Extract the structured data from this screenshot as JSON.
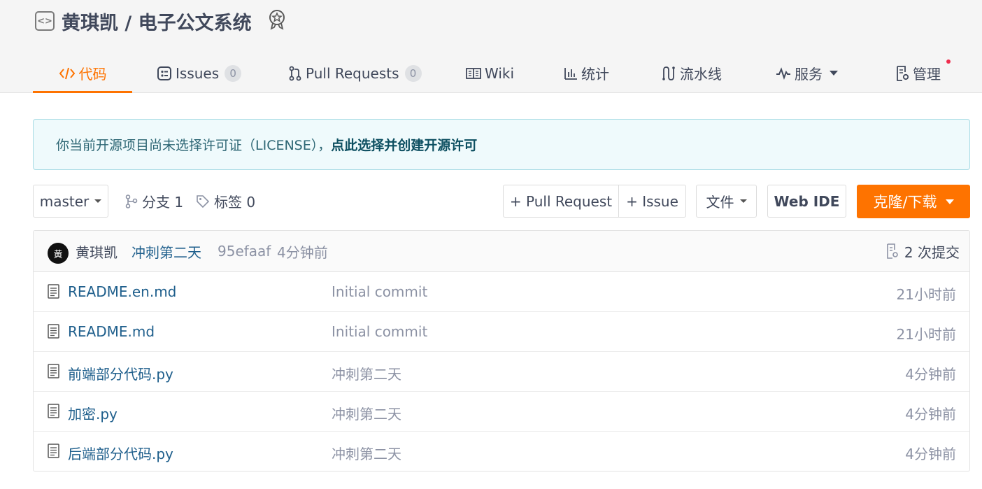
{
  "repo": {
    "title": "黄琪凯 / 电子公文系统",
    "repo_icon": "code-brackets-icon",
    "badge_icon": "award-icon"
  },
  "tabs": [
    {
      "label": "代码",
      "icon": "code-icon",
      "active": true
    },
    {
      "label": "Issues",
      "icon": "issues-icon",
      "count": "0"
    },
    {
      "label": "Pull Requests",
      "icon": "pull-request-icon",
      "count": "0"
    },
    {
      "label": "Wiki",
      "icon": "book-icon"
    },
    {
      "label": "统计",
      "icon": "bar-chart-icon"
    },
    {
      "label": "流水线",
      "icon": "pipeline-icon"
    },
    {
      "label": "服务",
      "icon": "activity-icon",
      "dropdown": true
    },
    {
      "label": "管理",
      "icon": "settings-doc-icon",
      "notification_dot": true
    }
  ],
  "notice": {
    "text": "你当前开源项目尚未选择许可证（LICENSE），",
    "link": "点此选择并创建开源许可"
  },
  "toolbar": {
    "branch": "master",
    "branches_label": "分支 1",
    "tags_label": "标签 0",
    "pull_request_button": "+ Pull Request",
    "issue_button": "+ Issue",
    "file_button": "文件",
    "web_ide_button": "Web IDE",
    "clone_button": "克隆/下载"
  },
  "last_commit": {
    "avatar_text": "黄",
    "author": "黄琪凯",
    "message": "冲刺第二天",
    "sha": "95efaaf",
    "time": "4分钟前",
    "commit_count": "2 次提交"
  },
  "files": [
    {
      "name": "README.en.md",
      "commit": "Initial commit",
      "time": "21小时前"
    },
    {
      "name": "README.md",
      "commit": "Initial commit",
      "time": "21小时前"
    },
    {
      "name": "前端部分代码.py",
      "commit": "冲刺第二天",
      "time": "4分钟前"
    },
    {
      "name": "加密.py",
      "commit": "冲刺第二天",
      "time": "4分钟前"
    },
    {
      "name": "后端部分代码.py",
      "commit": "冲刺第二天",
      "time": "4分钟前"
    }
  ],
  "colors": {
    "accent": "#fe7300",
    "link": "#1f5f8c",
    "notice_bg": "#effafc",
    "notice_border": "#a9dce5",
    "notification_dot": "#ef2d4d"
  }
}
